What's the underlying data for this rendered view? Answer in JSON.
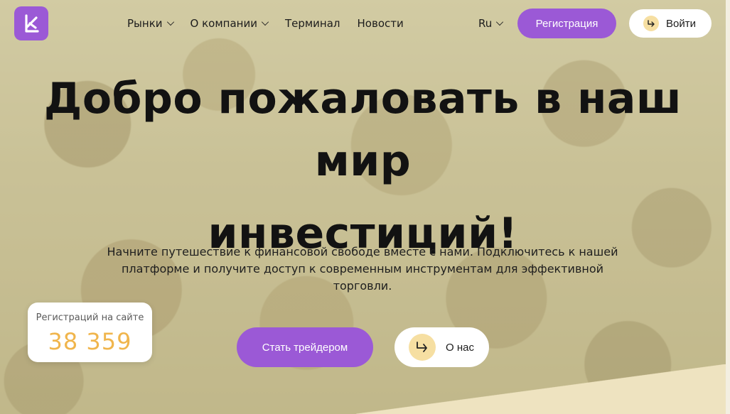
{
  "nav": {
    "items": [
      {
        "label": "Рынки",
        "has_dropdown": true
      },
      {
        "label": "О компании",
        "has_dropdown": true
      },
      {
        "label": "Терминал",
        "has_dropdown": false
      },
      {
        "label": "Новости",
        "has_dropdown": false
      }
    ],
    "language": "Ru",
    "register_label": "Регистрация",
    "login_label": "Войти"
  },
  "hero": {
    "title_line1": "Добро пожаловать в наш мир",
    "title_line2": "инвестиций!",
    "subtitle": "Начните путешествие к финансовой свободе вместе с нами. Подключитесь к нашей платформе и получите доступ к современным инструментам для эффективной торговли."
  },
  "stats": {
    "label": "Регистраций на сайте",
    "value": "38 359"
  },
  "cta": {
    "primary_label": "Стать трейдером",
    "secondary_label": "О нас"
  },
  "icons": {
    "logo": "brand-logo-icon",
    "dropdown": "chevron-down-icon",
    "login": "arrow-enter-icon",
    "about": "arrow-enter-icon"
  },
  "colors": {
    "accent": "#9b59d6",
    "stat_value": "#f0b54c",
    "icon_bg": "#f6dfa2"
  }
}
